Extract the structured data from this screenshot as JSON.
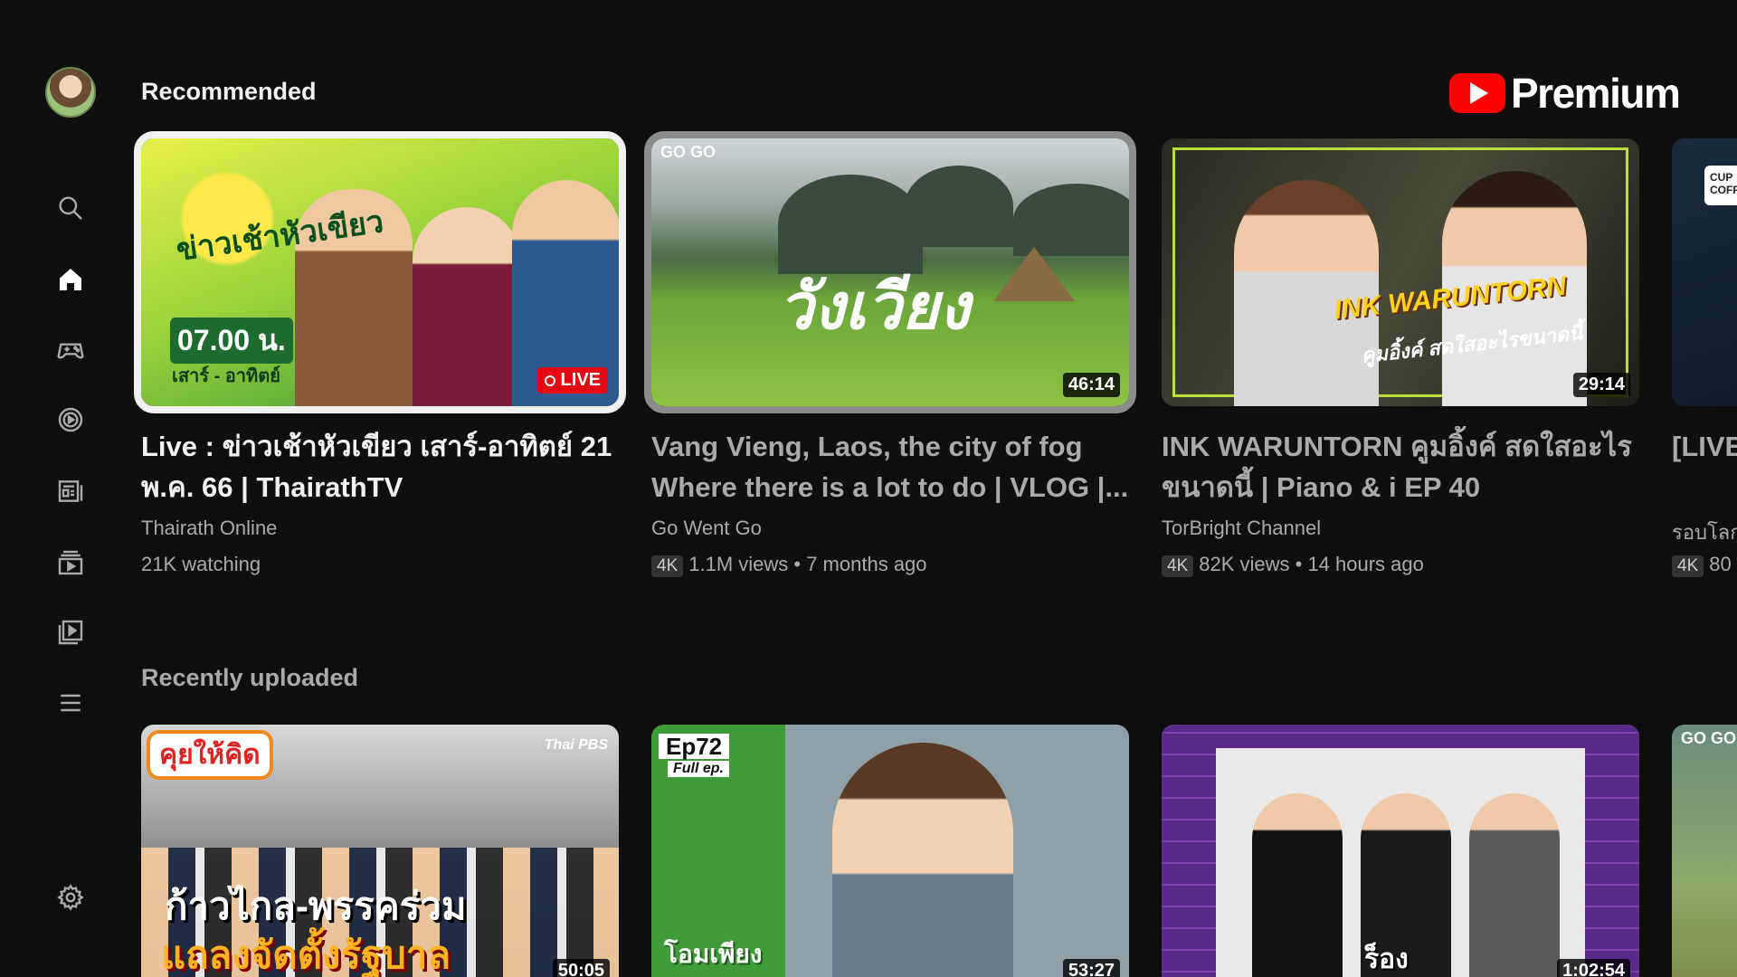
{
  "sidebar": {
    "items": [
      {
        "name": "search",
        "icon": "search-icon"
      },
      {
        "name": "home",
        "icon": "home-icon"
      },
      {
        "name": "gaming",
        "icon": "gamepad-icon"
      },
      {
        "name": "shorts",
        "icon": "play-circle-icon"
      },
      {
        "name": "subscriptions",
        "icon": "subscriptions-icon"
      },
      {
        "name": "library",
        "icon": "library-icon"
      },
      {
        "name": "playlists",
        "icon": "playlist-icon"
      },
      {
        "name": "more",
        "icon": "menu-icon"
      }
    ],
    "settings_icon": "gear-icon"
  },
  "header": {
    "logo_text": "Premium"
  },
  "sections": {
    "recommended": {
      "title": "Recommended",
      "cards": [
        {
          "title": "Live : ข่าวเช้าหัวเขียว เสาร์-อาทิตย์ 21 พ.ค. 66 | ThairathTV",
          "channel": "Thairath Online",
          "meta": "21K watching",
          "badge": "LIVE",
          "thumb_text": {
            "show": "ข่าวเช้าหัวเขียว",
            "time": "07.00 น.",
            "days": "เสาร์ - อาทิตย์"
          }
        },
        {
          "title": "Vang Vieng, Laos, the city of fog Where there is a lot to do | VLOG |...",
          "channel": "Go Went Go",
          "chip": "4K",
          "meta": "1.1M views • 7 months ago",
          "duration": "46:14",
          "thumb_text": {
            "main": "วังเวียง",
            "corner": "GO GO"
          }
        },
        {
          "title": "INK WARUNTORN คูมอิ้งค์ สดใสอะไร ขนาดนี้ | Piano & i EP 40",
          "channel": "TorBright Channel",
          "chip": "4K",
          "meta": "82K views • 14 hours ago",
          "duration": "29:14",
          "thumb_text": {
            "main": "INK WARUNTORN",
            "sub": "คูมอิ้งค์ สดใสอะไรขนาดนี้"
          }
        },
        {
          "title": "[LIVE Coffe",
          "channel": "รอบโลก",
          "chip": "4K",
          "meta": "80",
          "thumb_text": {
            "badge": "CUP COFF"
          }
        }
      ]
    },
    "recent": {
      "title": "Recently uploaded",
      "cards": [
        {
          "duration": "50:05",
          "thumb_text": {
            "tag": "คุยให้คิด",
            "logo": "Thai PBS",
            "line1": "ก้าวไกล-พรรคร่วม",
            "line2": "แถลงจัดตั้งรัฐบาล"
          }
        },
        {
          "duration": "53:27",
          "thumb_text": {
            "badge": "Ep72",
            "sub": "Full ep.",
            "title": "โอมเพียง"
          }
        },
        {
          "duration": "1:02:54",
          "thumb_text": {
            "title": "ร็อง"
          }
        },
        {
          "thumb_text": {
            "corner": "GO GO"
          }
        }
      ]
    }
  },
  "colors": {
    "background": "#0f0f0f",
    "accent_red": "#ff0000",
    "text_primary": "#f1f1f1",
    "text_secondary": "#aaaaaa"
  }
}
